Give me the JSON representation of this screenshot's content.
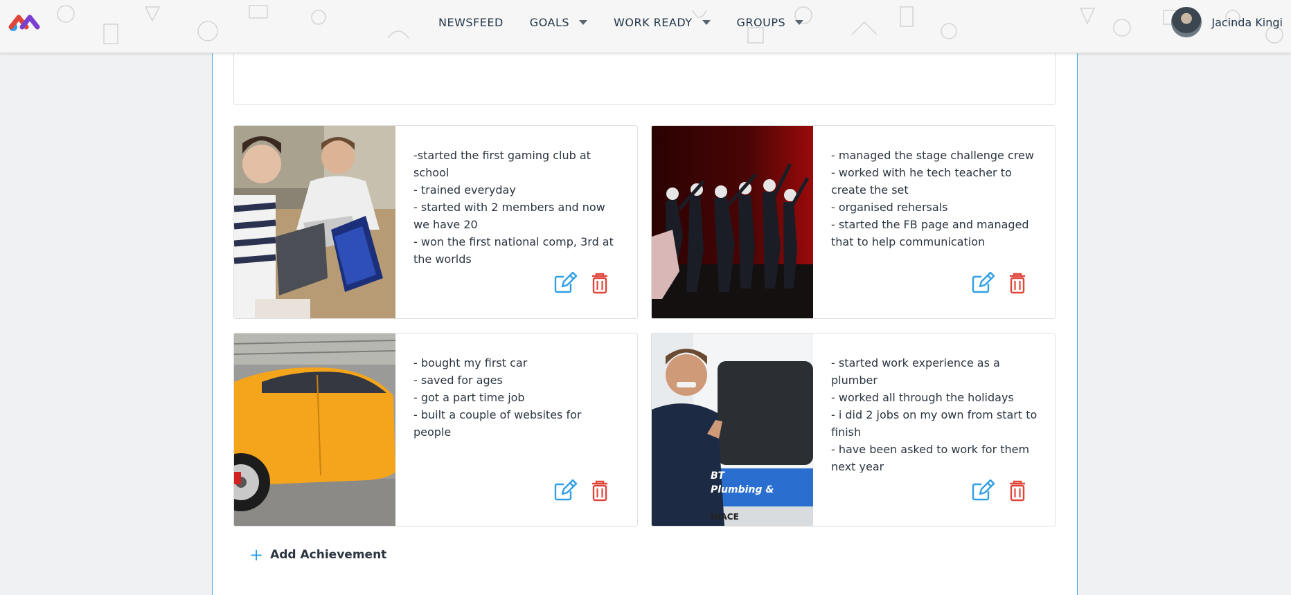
{
  "header": {
    "nav": [
      {
        "label": "NEWSFEED",
        "dropdown": false
      },
      {
        "label": "GOALS",
        "dropdown": true
      },
      {
        "label": "WORK READY",
        "dropdown": true
      },
      {
        "label": "GROUPS",
        "dropdown": true
      }
    ],
    "user_name": "Jacinda Kingi"
  },
  "achievements": [
    {
      "image_icon": "students-laptops-photo",
      "lines": [
        "-started the first gaming club at school",
        "- trained everyday",
        "- started with 2 members and now we have 20",
        "- won the first national comp, 3rd at the worlds"
      ]
    },
    {
      "image_icon": "stage-dancers-photo",
      "lines": [
        "- managed the stage challenge crew",
        "- worked with he tech teacher to create the set",
        "- organised rehersals",
        "- started the FB page and managed that to help communication"
      ]
    },
    {
      "image_icon": "yellow-car-photo",
      "lines": [
        "- bought my first car",
        "- saved for ages",
        "- got a part time job",
        "- built a couple of websites for people"
      ]
    },
    {
      "image_icon": "plumber-van-photo",
      "lines": [
        "- started work experience as a plumber",
        "- worked all through the holidays",
        "- i did 2 jobs on my own from start to finish",
        "- have been asked to work for them next year"
      ]
    }
  ],
  "van_text": {
    "line1": "BT",
    "line2": "Plumbing &",
    "line3": "HIACE"
  },
  "add_achievement_label": "Add Achievement",
  "colors": {
    "accent": "#2f9fe6",
    "delete": "#e0453a",
    "panel_border": "#4aa8e8"
  }
}
